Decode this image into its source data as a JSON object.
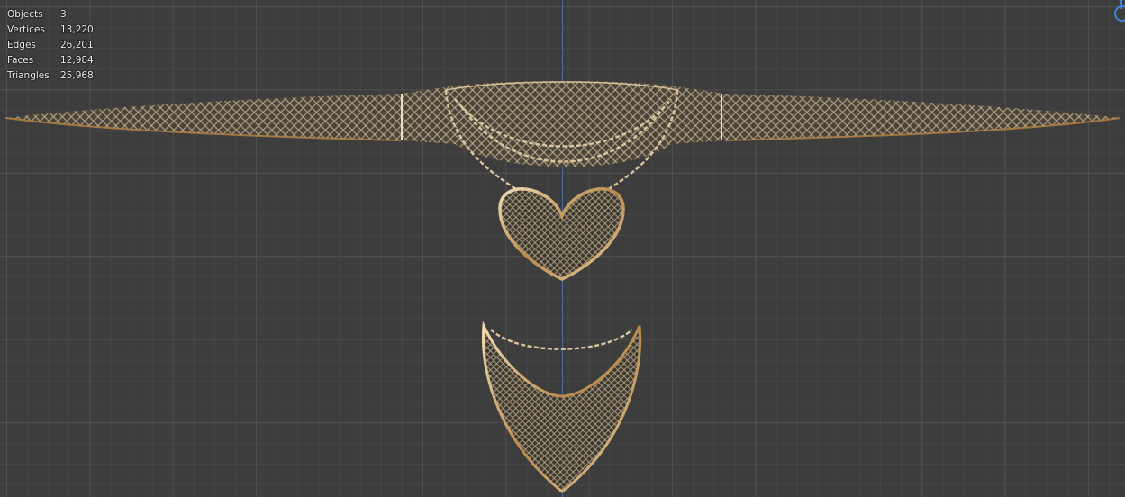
{
  "stats": {
    "rows": [
      {
        "label": "Objects",
        "value": "3"
      },
      {
        "label": "Vertices",
        "value": "13,220"
      },
      {
        "label": "Edges",
        "value": "26,201"
      },
      {
        "label": "Faces",
        "value": "12,984"
      },
      {
        "label": "Triangles",
        "value": "25,968"
      }
    ]
  },
  "gizmo": {
    "icon": "navigation-gizmo-icon",
    "color": "#3f82d6"
  },
  "colors": {
    "background": "#3d3d3d",
    "axis": "#4a73b8",
    "gold": "#c8a46a",
    "mesh_dark": "#4a4236"
  }
}
